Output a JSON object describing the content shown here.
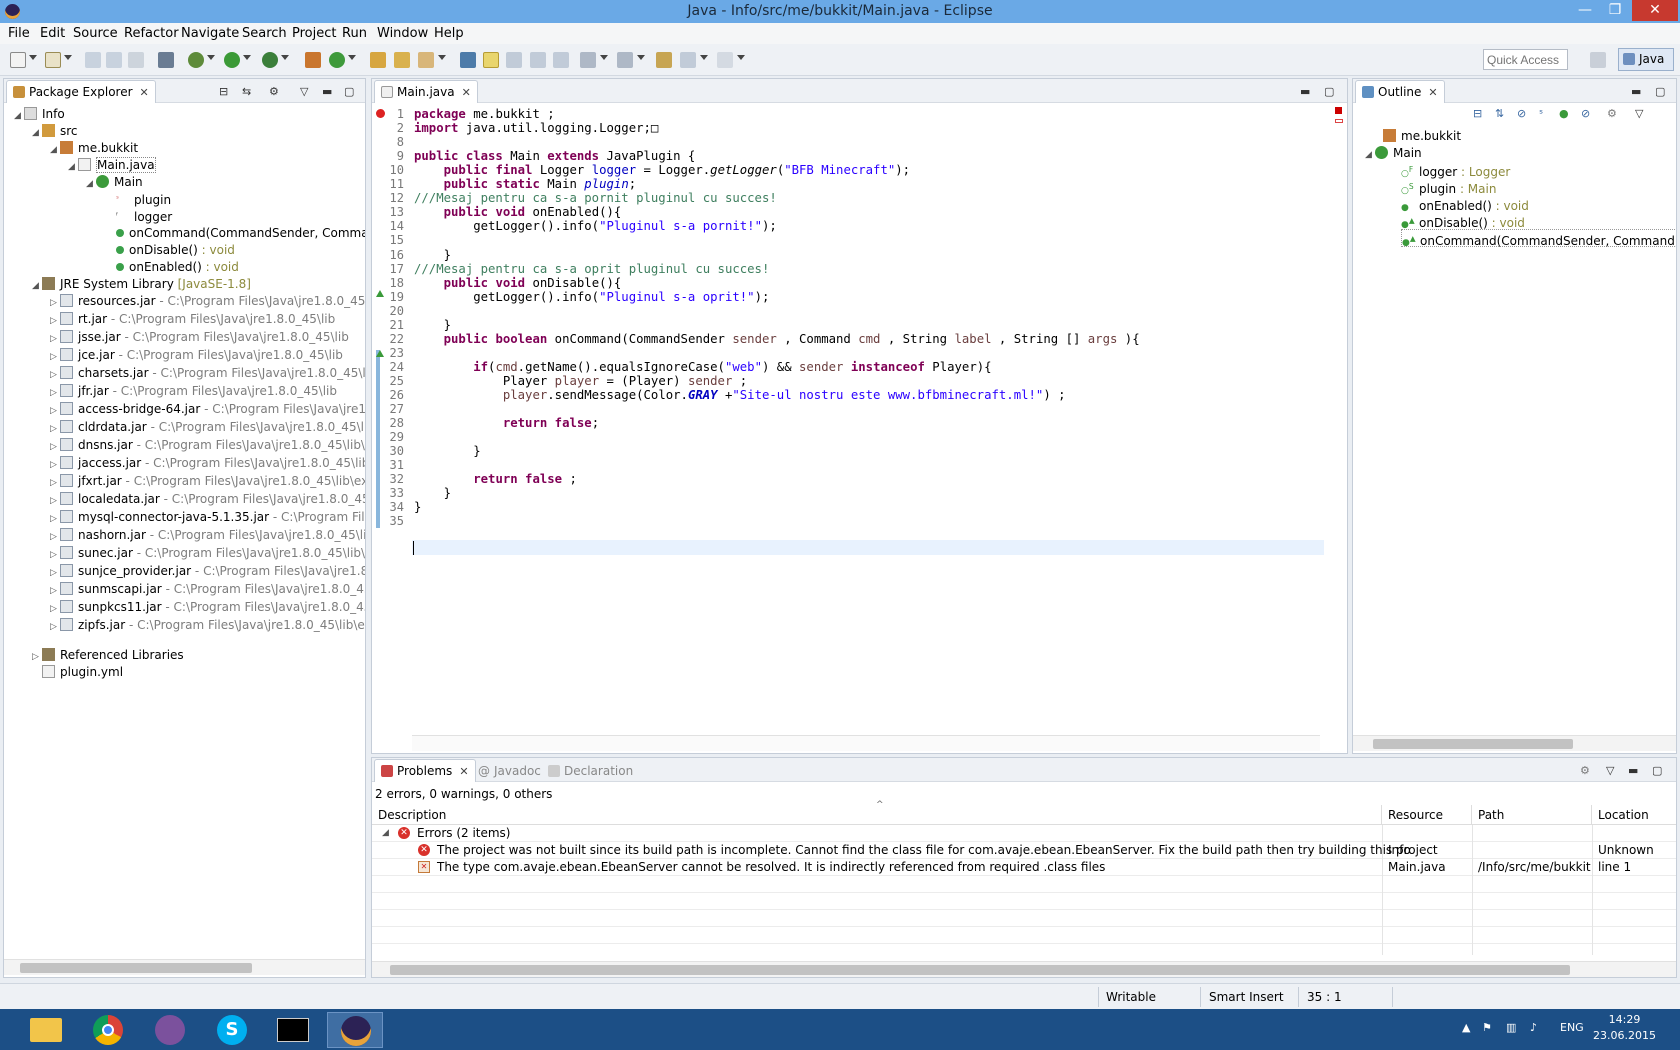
{
  "window": {
    "title": "Java - Info/src/me/bukkit/Main.java - Eclipse",
    "minimize": "—",
    "maximize": "❐",
    "close": "✕"
  },
  "menu": [
    "File",
    "Edit",
    "Source",
    "Refactor",
    "Navigate",
    "Search",
    "Project",
    "Run",
    "Window",
    "Help"
  ],
  "toolbar": {
    "quick_access_placeholder": "Quick Access",
    "perspective": "Java"
  },
  "package_explorer": {
    "tab": "Package Explorer",
    "project": "Info",
    "src": "src",
    "package": "me.bukkit",
    "file": "Main.java",
    "class": "Main",
    "members": [
      {
        "name": "plugin",
        "type": ""
      },
      {
        "name": "logger",
        "type": ""
      },
      {
        "name": "onCommand(CommandSender, Commar",
        "type": ""
      },
      {
        "name": "onDisable()",
        "type": " : void"
      },
      {
        "name": "onEnabled()",
        "type": " : void"
      }
    ],
    "jre": {
      "name": "JRE System Library",
      "env": " [JavaSE-1.8]"
    },
    "jars": [
      {
        "name": "resources.jar",
        "path": " - C:\\Program Files\\Java\\jre1.8.0_45\\lib"
      },
      {
        "name": "rt.jar",
        "path": " - C:\\Program Files\\Java\\jre1.8.0_45\\lib"
      },
      {
        "name": "jsse.jar",
        "path": " - C:\\Program Files\\Java\\jre1.8.0_45\\lib"
      },
      {
        "name": "jce.jar",
        "path": " - C:\\Program Files\\Java\\jre1.8.0_45\\lib"
      },
      {
        "name": "charsets.jar",
        "path": " - C:\\Program Files\\Java\\jre1.8.0_45\\lib"
      },
      {
        "name": "jfr.jar",
        "path": " - C:\\Program Files\\Java\\jre1.8.0_45\\lib"
      },
      {
        "name": "access-bridge-64.jar",
        "path": " - C:\\Program Files\\Java\\jre1.8.0"
      },
      {
        "name": "cldrdata.jar",
        "path": " - C:\\Program Files\\Java\\jre1.8.0_45\\lib\\ex"
      },
      {
        "name": "dnsns.jar",
        "path": " - C:\\Program Files\\Java\\jre1.8.0_45\\lib\\ext"
      },
      {
        "name": "jaccess.jar",
        "path": " - C:\\Program Files\\Java\\jre1.8.0_45\\lib\\ext"
      },
      {
        "name": "jfxrt.jar",
        "path": " - C:\\Program Files\\Java\\jre1.8.0_45\\lib\\ext"
      },
      {
        "name": "localedata.jar",
        "path": " - C:\\Program Files\\Java\\jre1.8.0_45\\lib\\"
      },
      {
        "name": "mysql-connector-java-5.1.35.jar",
        "path": " - C:\\Program Files\\J"
      },
      {
        "name": "nashorn.jar",
        "path": " - C:\\Program Files\\Java\\jre1.8.0_45\\lib\\ext"
      },
      {
        "name": "sunec.jar",
        "path": " - C:\\Program Files\\Java\\jre1.8.0_45\\lib\\ext"
      },
      {
        "name": "sunjce_provider.jar",
        "path": " - C:\\Program Files\\Java\\jre1.8.0_4"
      },
      {
        "name": "sunmscapi.jar",
        "path": " - C:\\Program Files\\Java\\jre1.8.0_45\\lib\\"
      },
      {
        "name": "sunpkcs11.jar",
        "path": " - C:\\Program Files\\Java\\jre1.8.0_45\\lib\\"
      },
      {
        "name": "zipfs.jar",
        "path": " - C:\\Program Files\\Java\\jre1.8.0_45\\lib\\ext"
      }
    ],
    "referenced": "Referenced Libraries",
    "yml": "plugin.yml"
  },
  "editor": {
    "tab": "Main.java",
    "lines": [
      {
        "n": "1",
        "html": "<span class='kw'>package</span> me.bukkit ;"
      },
      {
        "n": "2",
        "html": "<span class='kw'>import</span> java.util.logging.Logger;&#9633;"
      },
      {
        "n": "8",
        "html": ""
      },
      {
        "n": "9",
        "html": "<span class='kw'>public class</span> Main <span class='kw'>extends</span> JavaPlugin {"
      },
      {
        "n": "10",
        "html": "    <span class='kw'>public final</span> Logger <span class='fld'>logger</span> = Logger.<span class='it'>getLogger</span>(<span class='str'>\"BFB Minecraft\"</span>);"
      },
      {
        "n": "11",
        "html": "    <span class='kw'>public static</span> Main <span class='fld it'>plugin</span>;"
      },
      {
        "n": "12",
        "html": "<span class='cm'>///Mesaj pentru ca s-a pornit pluginul cu succes!</span>"
      },
      {
        "n": "13",
        "html": "    <span class='kw'>public void</span> onEnabled(){"
      },
      {
        "n": "14",
        "html": "        getLogger().info(<span class='str'>\"Pluginul s-a pornit!\"</span>);"
      },
      {
        "n": "15",
        "html": ""
      },
      {
        "n": "16",
        "html": "    }"
      },
      {
        "n": "17",
        "html": "<span class='cm'>///Mesaj pentru ca s-a oprit pluginul cu succes!</span>"
      },
      {
        "n": "18",
        "html": "    <span class='kw'>public void</span> onDisable(){"
      },
      {
        "n": "19",
        "html": "        getLogger().info(<span class='str'>\"Pluginul s-a oprit!\"</span>);"
      },
      {
        "n": "20",
        "html": ""
      },
      {
        "n": "21",
        "html": "    }"
      },
      {
        "n": "22",
        "html": "    <span class='kw'>public boolean</span> onCommand(CommandSender <span class='prm'>sender</span> , Command <span class='prm'>cmd</span> , String <span class='prm'>label</span> , String [] <span class='prm'>args</span> ){"
      },
      {
        "n": "23",
        "html": ""
      },
      {
        "n": "24",
        "html": "        <span class='kw'>if</span>(<span class='prm'>cmd</span>.getName().equalsIgnoreCase(<span class='str'>\"web\"</span>) &amp;&amp; <span class='prm'>sender</span> <span class='kw'>instanceof</span> Player){"
      },
      {
        "n": "25",
        "html": "            Player <span class='prm'>player</span> = (Player) <span class='prm'>sender</span> ;"
      },
      {
        "n": "26",
        "html": "            <span class='prm'>player</span>.sendMessage(Color.<span class='sfld'>GRAY</span> +<span class='str'>\"Site-ul nostru este www.bfbminecraft.ml!\"</span>) ;"
      },
      {
        "n": "27",
        "html": ""
      },
      {
        "n": "28",
        "html": "            <span class='kw'>return false</span>;"
      },
      {
        "n": "29",
        "html": ""
      },
      {
        "n": "30",
        "html": "        }"
      },
      {
        "n": "31",
        "html": ""
      },
      {
        "n": "32",
        "html": "        <span class='kw'>return false</span> ;"
      },
      {
        "n": "33",
        "html": "    }"
      },
      {
        "n": "34",
        "html": "}"
      },
      {
        "n": "35",
        "html": ""
      }
    ]
  },
  "outline": {
    "tab": "Outline",
    "package": "me.bukkit",
    "class": "Main",
    "items": [
      {
        "name": "logger",
        "type": " : Logger",
        "sup": "F"
      },
      {
        "name": "plugin",
        "type": " : Main",
        "sup": "S"
      },
      {
        "name": "onEnabled()",
        "type": " : void",
        "sup": ""
      },
      {
        "name": "onDisable()",
        "type": " : void",
        "sup": "▲"
      },
      {
        "name": "onCommand(CommandSender, Command, S",
        "type": "",
        "sup": "▲"
      }
    ]
  },
  "problems": {
    "tabs": [
      "Problems",
      "Javadoc",
      "Declaration"
    ],
    "summary": "2 errors, 0 warnings, 0 others",
    "columns": [
      "Description",
      "Resource",
      "Path",
      "Location"
    ],
    "group": "Errors (2 items)",
    "rows": [
      {
        "desc": "The project was not built since its build path is incomplete. Cannot find the class file for com.avaje.ebean.EbeanServer. Fix the build path then try building this project",
        "resource": "Info",
        "path": "",
        "location": "Unknown"
      },
      {
        "desc": "The type com.avaje.ebean.EbeanServer cannot be resolved. It is indirectly referenced from required .class files",
        "resource": "Main.java",
        "path": "/Info/src/me/bukkit",
        "location": "line 1"
      }
    ]
  },
  "status": {
    "writable": "Writable",
    "insert": "Smart Insert",
    "position": "35 : 1"
  },
  "taskbar": {
    "lang": "ENG",
    "time": "14:29",
    "date": "23.06.2015"
  },
  "colors": {
    "keyword": "#7f0055",
    "string": "#2a00ff",
    "comment": "#3f7f5f",
    "field": "#0000c0",
    "taskbar": "#1c4f86"
  }
}
